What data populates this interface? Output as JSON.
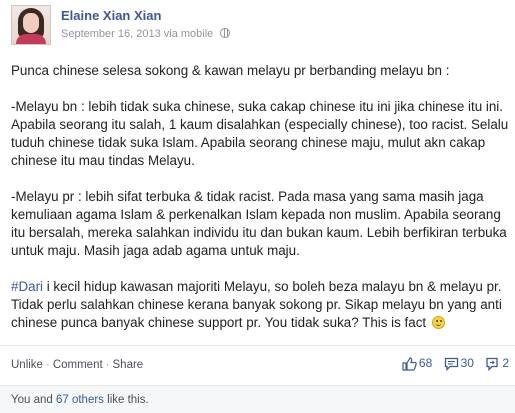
{
  "post": {
    "author": "Elaine Xian Xian",
    "date": "September 16, 2013",
    "via": "via mobile",
    "paragraphs": [
      [
        "Punca chinese selesa sokong & kawan melayu pr berbanding melayu bn :"
      ],
      [
        "-Melayu bn : lebih tidak suka chinese, suka cakap chinese itu ini jika chinese itu ini.",
        "Apabila seorang itu salah, 1 kaum disalahkan (especially chinese), too racist. Selalu",
        "tuduh chinese tidak suka Islam. Apabila seorang chinese maju, mulut akn cakap",
        "chinese itu mau tindas Melayu."
      ],
      [
        "-Melayu pr : lebih sifat terbuka & tidak racist. Pada masa yang sama masih jaga",
        "kemuliaan agama Islam & perkenalkan Islam kepada non muslim. Apabila seorang",
        "itu bersalah, mereka salahkan individu itu dan bukan kaum. Lebih berfikiran terbuka",
        "untuk maju. Masih jaga adab agama untuk maju."
      ]
    ],
    "last_paragraph": {
      "hashtag": "#Dari",
      "line1_rest": " i kecil hidup kawasan majoriti Melayu, so boleh beza malayu bn & melayu pr.",
      "line2": "Tidak perlu salahkan chinese kerana banyak sokong pr. Sikap melayu bn yang anti",
      "line3": "chinese punca banyak chinese support pr. You tidak suka? This is fact"
    }
  },
  "actions": {
    "unlike": "Unlike",
    "comment": "Comment",
    "share": "Share",
    "separator": "·"
  },
  "counts": {
    "likes": "68",
    "comments": "30",
    "shares": "2"
  },
  "likes_summary": {
    "you": "You and ",
    "others": "67 others",
    "tail": " like this."
  },
  "icons": {
    "avatar": "profile-photo",
    "privacy": "globe-icon",
    "like": "thumbs-up-icon",
    "comment": "speech-bubble-icon",
    "share": "share-icon",
    "emoji": "smiley-icon"
  },
  "colors": {
    "link": "#3b5998",
    "meta": "#90949c",
    "text": "#222222"
  }
}
